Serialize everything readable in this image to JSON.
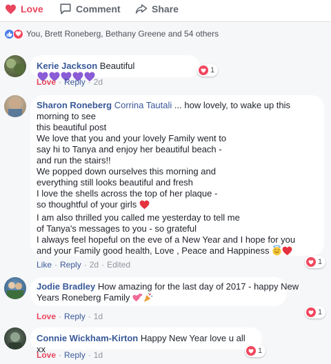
{
  "actions": {
    "love": "Love",
    "comment": "Comment",
    "share": "Share"
  },
  "reactions_summary": "You, Brett Roneberg, Bethany Greene and 54 others",
  "comments": [
    {
      "author": "Kerie Jackson",
      "text": "Beautiful",
      "emojis": [
        "purple-heart",
        "purple-heart",
        "purple-heart",
        "purple-heart",
        "purple-heart"
      ],
      "reaction_label": "Love",
      "reply_label": "Reply",
      "time": "2d",
      "reaction_count": "1"
    },
    {
      "author": "Sharon Roneberg",
      "tagged": "Corrina Tautali",
      "lines": [
        "... how lovely, to wake up this",
        "morning to see",
        "this beautiful post",
        "We love that you and your lovely Family went to",
        "say hi to Tanya and enjoy her beautiful beach -",
        "and run the stairs!!",
        "We popped down ourselves this morning and",
        "everything still looks beautiful and fresh",
        "I love the shells across the top of her plaque -",
        "so thoughtful of your girls",
        "I am also thrilled you called me yesterday to tell me",
        "of Tanya's messages to you - so grateful",
        "I always feel hopeful on the eve of a New Year and I hope for you",
        "and your Family good health, Love , Peace and Happiness"
      ],
      "reaction_label": "Like",
      "reply_label": "Reply",
      "time": "2d",
      "edited": "Edited",
      "reaction_count": "1"
    },
    {
      "author": "Jodie Bradley",
      "lines": [
        "How amazing for the last day of 2017 - happy New",
        "Years Roneberg Family"
      ],
      "reaction_label": "Love",
      "reply_label": "Reply",
      "time": "1d",
      "reaction_count": "1"
    },
    {
      "author": "Connie Wickham-Kirton",
      "text": "Happy New Year love u all xx",
      "reaction_label": "Love",
      "reply_label": "Reply",
      "time": "1d",
      "reaction_count": "1"
    }
  ],
  "colors": {
    "love": "#e9455c",
    "link": "#385898",
    "meta": "#90949c",
    "like_badge": "#4a7be8"
  },
  "icons": [
    "heart-icon",
    "comment-icon",
    "share-icon",
    "like-badge-icon",
    "love-badge-icon",
    "purple-heart-icon",
    "red-heart-icon",
    "angel-emoji-icon",
    "hearts-emoji-icon",
    "party-emoji-icon"
  ]
}
